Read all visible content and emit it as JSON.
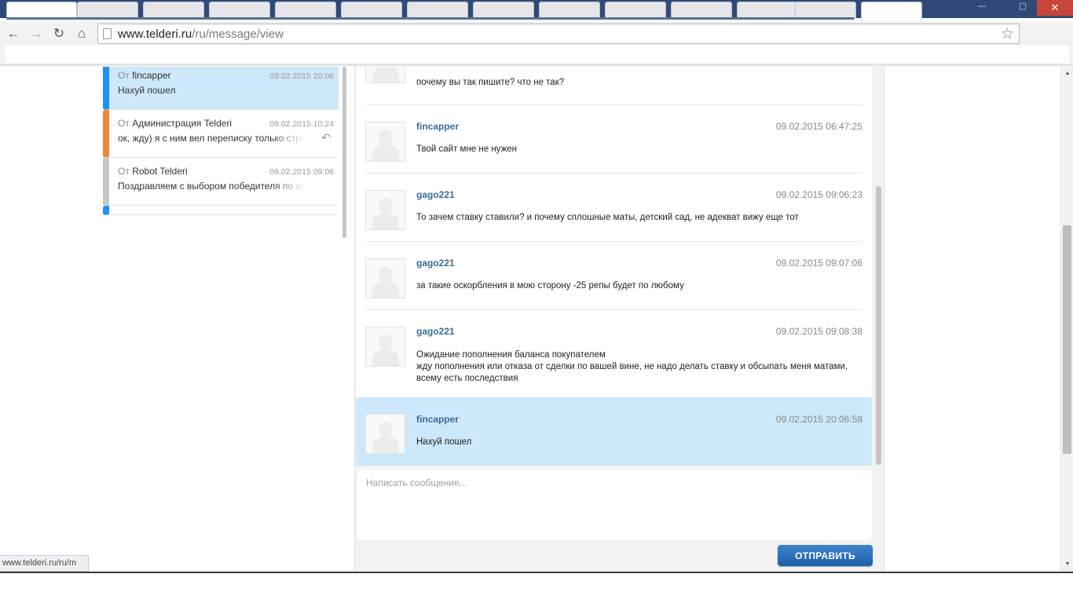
{
  "browser": {
    "url_host": "www.telderi.ru",
    "url_path": "/ru/message/view",
    "window_close": "✕",
    "window_minimize": "—",
    "window_restore": "▢"
  },
  "dialogs": [
    {
      "prefix": "От",
      "name": "fincapper",
      "date": "09.02.2015 20:06",
      "snippet": "Нахуй пошел"
    },
    {
      "prefix": "От",
      "name": "Администрация Telderi",
      "date": "09.02.2015 10:24",
      "snippet": "ок, жду) я с ним вел переписку только строго"
    },
    {
      "prefix": "От",
      "name": "Robot Telderi",
      "date": "09.02.2015 09:08",
      "snippet": "Поздравляем с выбором победителя по аукциону"
    }
  ],
  "messages": [
    {
      "author": "",
      "time": "",
      "lines": [
        "почему вы так пишите? что не так?"
      ]
    },
    {
      "author": "fincapper",
      "time": "09.02.2015 06:47:25",
      "lines": [
        "Твой сайт мне не нужен"
      ]
    },
    {
      "author": "gago221",
      "time": "09.02.2015 09:06:23",
      "lines": [
        "То зачем ставку ставили? и почему сплошные маты, детский сад, не адекват вижу еще тот"
      ]
    },
    {
      "author": "gago221",
      "time": "09.02.2015 09:07:06",
      "lines": [
        "за такие оскорбления в мою сторону -25 репы будет по любому"
      ]
    },
    {
      "author": "gago221",
      "time": "09.02.2015 09:08:38",
      "lines": [
        "Ожидание пополнения баланса покупателем",
        "жду пополнения или отказа от сделки по вашей вине, не надо делать ставку и обсыпать меня матами, всему есть последствия"
      ]
    },
    {
      "author": "fincapper",
      "time": "09.02.2015 20:06:58",
      "lines": [
        "Нахуй пошел"
      ]
    }
  ],
  "compose": {
    "placeholder": "Написать сообщение...",
    "send_label": "ОТПРАВИТЬ"
  },
  "status_url": "www.telderi.ru/ru/m"
}
